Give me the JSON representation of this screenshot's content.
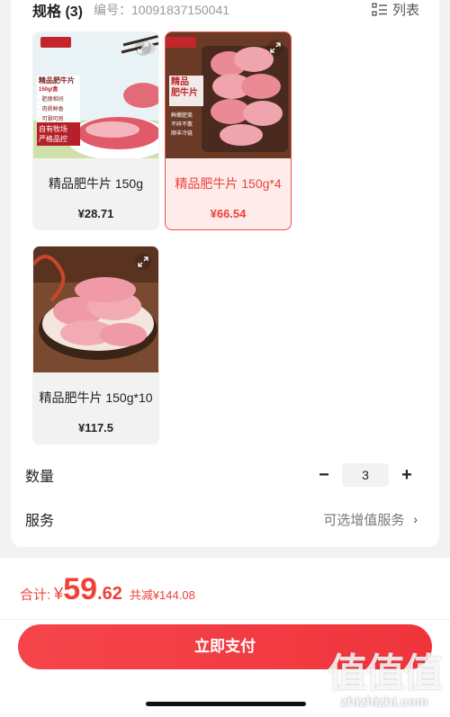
{
  "spec": {
    "title": "规格 (3)",
    "code": "编号：10091837150041",
    "list_toggle_label": "列表"
  },
  "skus": [
    {
      "name": "精品肥牛片 150g",
      "price": "¥28.71",
      "selected": false,
      "image_text": [
        "精品肥牛片",
        "150g/盒",
        "· 肥瘦相间",
        "· 肉质鲜香",
        "· 可涮可煎",
        "自有牧场",
        "严格品控"
      ]
    },
    {
      "name": "精品肥牛片 150g*4",
      "price": "¥66.54",
      "selected": true,
      "image_text": [
        "精品",
        "肥牛片",
        "鲜嫩肥美",
        "不碎不散",
        "顺丰冷链"
      ]
    },
    {
      "name": "精品肥牛片 150g*10",
      "price": "¥117.5",
      "selected": false,
      "image_text": []
    }
  ],
  "quantity": {
    "label": "数量",
    "value": "3",
    "minus": "−",
    "plus": "+"
  },
  "service": {
    "label": "服务",
    "value": "可选增值服务",
    "chevron": "›"
  },
  "summary": {
    "label": "合计:",
    "yen": "¥",
    "int": "59",
    "dec": ".62",
    "discount": "共减¥144.08"
  },
  "pay_button": "立即支付",
  "watermark": {
    "chars": "值值值",
    "url": "zhizhizhi.com"
  },
  "colors": {
    "accent": "#f0403a"
  }
}
